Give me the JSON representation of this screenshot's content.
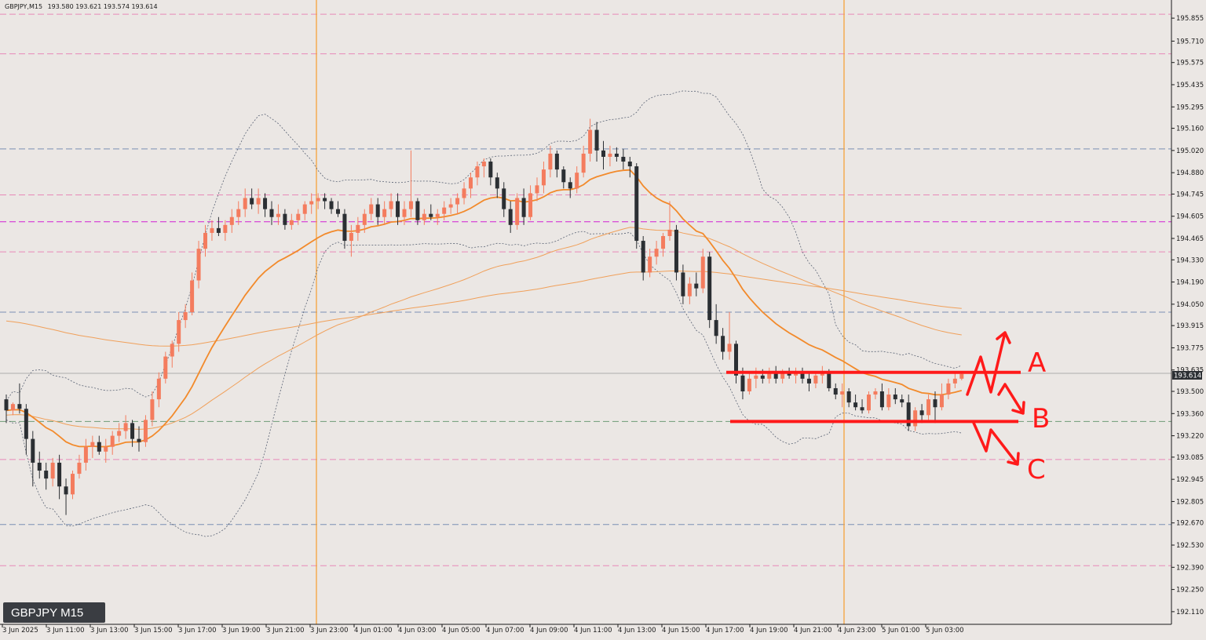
{
  "header": {
    "symbol_info": "GBPJPY,M15",
    "ohlc": "193.580 193.621 193.574 193.614"
  },
  "watermark": "GBPJPY M15",
  "current_price": "193.614",
  "scenario_labels": [
    "A",
    "B",
    "C"
  ],
  "colors": {
    "background": "#ebe7e4",
    "bull": "#f47c5e",
    "bear": "#2b2f33",
    "ema_fast": "#f28a2b",
    "ema_slow": "#f0a05a",
    "bands": "#5b6475",
    "session_line": "#f5a23a",
    "level_pink": "#e889b8",
    "level_magenta": "#d21fd2",
    "level_blue": "#7b8fb3",
    "level_green": "#6e9a76",
    "annotation": "#ff1a1a"
  },
  "chart_data": {
    "type": "candlestick",
    "title": "",
    "symbol": "GBPJPY",
    "timeframe": "M15",
    "ylim": [
      192.05,
      195.92
    ],
    "y_ticks": [
      "195.855",
      "195.710",
      "195.575",
      "195.435",
      "195.295",
      "195.160",
      "195.020",
      "194.880",
      "194.745",
      "194.605",
      "194.465",
      "194.330",
      "194.190",
      "194.050",
      "193.915",
      "193.775",
      "193.635",
      "193.500",
      "193.360",
      "193.220",
      "193.085",
      "192.945",
      "192.805",
      "192.670",
      "192.530",
      "192.390",
      "192.250",
      "192.110"
    ],
    "x_ticks": [
      "3 Jun 2025",
      "3 Jun 11:00",
      "3 Jun 13:00",
      "3 Jun 15:00",
      "3 Jun 17:00",
      "3 Jun 19:00",
      "3 Jun 21:00",
      "3 Jun 23:00",
      "4 Jun 01:00",
      "4 Jun 03:00",
      "4 Jun 05:00",
      "4 Jun 07:00",
      "4 Jun 09:00",
      "4 Jun 11:00",
      "4 Jun 13:00",
      "4 Jun 15:00",
      "4 Jun 17:00",
      "4 Jun 19:00",
      "4 Jun 21:00",
      "4 Jun 23:00",
      "5 Jun 01:00",
      "5 Jun 03:00"
    ],
    "candles": [
      [
        193.45,
        193.48,
        193.3,
        193.38
      ],
      [
        193.38,
        193.43,
        193.35,
        193.42
      ],
      [
        193.42,
        193.55,
        193.36,
        193.39
      ],
      [
        193.39,
        193.42,
        193.1,
        193.2
      ],
      [
        193.2,
        193.25,
        192.9,
        193.05
      ],
      [
        193.05,
        193.12,
        192.95,
        193.0
      ],
      [
        193.0,
        193.05,
        192.88,
        192.95
      ],
      [
        192.95,
        193.08,
        192.9,
        193.05
      ],
      [
        193.05,
        193.1,
        192.82,
        192.9
      ],
      [
        192.9,
        192.95,
        192.72,
        192.85
      ],
      [
        192.85,
        193.0,
        192.82,
        192.98
      ],
      [
        192.98,
        193.1,
        192.95,
        193.05
      ],
      [
        193.05,
        193.2,
        193.0,
        193.15
      ],
      [
        193.15,
        193.22,
        193.08,
        193.18
      ],
      [
        193.18,
        193.22,
        193.1,
        193.12
      ],
      [
        193.12,
        193.2,
        193.05,
        193.15
      ],
      [
        193.15,
        193.25,
        193.1,
        193.22
      ],
      [
        193.22,
        193.3,
        193.18,
        193.25
      ],
      [
        193.25,
        193.35,
        193.2,
        193.3
      ],
      [
        193.3,
        193.32,
        193.15,
        193.2
      ],
      [
        193.2,
        193.28,
        193.12,
        193.18
      ],
      [
        193.18,
        193.35,
        193.15,
        193.32
      ],
      [
        193.32,
        193.5,
        193.28,
        193.45
      ],
      [
        193.45,
        193.62,
        193.4,
        193.58
      ],
      [
        193.58,
        193.75,
        193.55,
        193.72
      ],
      [
        193.72,
        193.82,
        193.65,
        193.8
      ],
      [
        193.8,
        194.0,
        193.75,
        193.95
      ],
      [
        193.95,
        194.05,
        193.9,
        194.0
      ],
      [
        194.0,
        194.25,
        193.98,
        194.2
      ],
      [
        194.2,
        194.45,
        194.15,
        194.4
      ],
      [
        194.4,
        194.55,
        194.35,
        194.5
      ],
      [
        194.5,
        194.58,
        194.45,
        194.53
      ],
      [
        194.53,
        194.6,
        194.48,
        194.5
      ],
      [
        194.5,
        194.58,
        194.45,
        194.55
      ],
      [
        194.55,
        194.65,
        194.5,
        194.6
      ],
      [
        194.6,
        194.7,
        194.55,
        194.65
      ],
      [
        194.65,
        194.78,
        194.6,
        194.72
      ],
      [
        194.72,
        194.78,
        194.65,
        194.68
      ],
      [
        194.68,
        194.78,
        194.62,
        194.72
      ],
      [
        194.72,
        194.75,
        194.6,
        194.65
      ],
      [
        194.65,
        194.7,
        194.55,
        194.6
      ],
      [
        194.6,
        194.68,
        194.55,
        194.62
      ],
      [
        194.62,
        194.65,
        194.52,
        194.55
      ],
      [
        194.55,
        194.62,
        194.52,
        194.58
      ],
      [
        194.58,
        194.65,
        194.55,
        194.62
      ],
      [
        194.62,
        194.7,
        194.58,
        194.68
      ],
      [
        194.68,
        194.75,
        194.62,
        194.7
      ],
      [
        194.7,
        194.75,
        194.65,
        194.72
      ],
      [
        194.72,
        194.75,
        194.65,
        194.7
      ],
      [
        194.7,
        194.72,
        194.62,
        194.65
      ],
      [
        194.65,
        194.7,
        194.6,
        194.62
      ],
      [
        194.62,
        194.65,
        194.4,
        194.45
      ],
      [
        194.45,
        194.55,
        194.35,
        194.5
      ],
      [
        194.5,
        194.6,
        194.45,
        194.55
      ],
      [
        194.55,
        194.65,
        194.5,
        194.62
      ],
      [
        194.62,
        194.72,
        194.58,
        194.68
      ],
      [
        194.68,
        194.72,
        194.55,
        194.6
      ],
      [
        194.6,
        194.7,
        194.55,
        194.65
      ],
      [
        194.65,
        194.75,
        194.6,
        194.7
      ],
      [
        194.7,
        194.75,
        194.55,
        194.6
      ],
      [
        194.6,
        194.7,
        194.55,
        194.65
      ],
      [
        194.65,
        195.02,
        194.6,
        194.7
      ],
      [
        194.7,
        194.72,
        194.55,
        194.58
      ],
      [
        194.58,
        194.65,
        194.55,
        194.62
      ],
      [
        194.62,
        194.68,
        194.58,
        194.6
      ],
      [
        194.6,
        194.65,
        194.55,
        194.62
      ],
      [
        194.62,
        194.7,
        194.58,
        194.66
      ],
      [
        194.66,
        194.72,
        194.62,
        194.68
      ],
      [
        194.68,
        194.75,
        194.62,
        194.72
      ],
      [
        194.72,
        194.82,
        194.68,
        194.78
      ],
      [
        194.78,
        194.88,
        194.72,
        194.85
      ],
      [
        194.85,
        194.95,
        194.8,
        194.92
      ],
      [
        194.92,
        194.97,
        194.85,
        194.95
      ],
      [
        194.95,
        194.97,
        194.8,
        194.85
      ],
      [
        194.85,
        194.88,
        194.72,
        194.78
      ],
      [
        194.78,
        194.82,
        194.6,
        194.65
      ],
      [
        194.65,
        194.7,
        194.5,
        194.55
      ],
      [
        194.55,
        194.75,
        194.52,
        194.72
      ],
      [
        194.72,
        194.78,
        194.55,
        194.6
      ],
      [
        194.6,
        194.8,
        194.58,
        194.75
      ],
      [
        194.75,
        194.85,
        194.7,
        194.8
      ],
      [
        194.8,
        194.95,
        194.75,
        194.9
      ],
      [
        194.9,
        195.05,
        194.85,
        195.0
      ],
      [
        195.0,
        195.02,
        194.85,
        194.9
      ],
      [
        194.9,
        194.92,
        194.78,
        194.82
      ],
      [
        194.82,
        194.85,
        194.72,
        194.78
      ],
      [
        194.78,
        194.92,
        194.75,
        194.88
      ],
      [
        194.88,
        195.05,
        194.85,
        195.0
      ],
      [
        195.0,
        195.22,
        194.95,
        195.15
      ],
      [
        195.15,
        195.2,
        194.95,
        195.02
      ],
      [
        195.02,
        195.08,
        194.9,
        194.98
      ],
      [
        194.98,
        195.05,
        194.92,
        195.0
      ],
      [
        195.0,
        195.04,
        194.95,
        194.98
      ],
      [
        194.98,
        195.03,
        194.9,
        194.95
      ],
      [
        194.95,
        194.98,
        194.85,
        194.92
      ],
      [
        194.92,
        194.94,
        194.4,
        194.45
      ],
      [
        194.45,
        194.48,
        194.2,
        194.25
      ],
      [
        194.25,
        194.4,
        194.22,
        194.35
      ],
      [
        194.35,
        194.45,
        194.3,
        194.4
      ],
      [
        194.4,
        194.5,
        194.35,
        194.48
      ],
      [
        194.48,
        194.7,
        194.45,
        194.52
      ],
      [
        194.52,
        194.55,
        194.2,
        194.25
      ],
      [
        194.25,
        194.3,
        194.05,
        194.1
      ],
      [
        194.1,
        194.22,
        194.05,
        194.18
      ],
      [
        194.18,
        194.25,
        194.1,
        194.15
      ],
      [
        194.15,
        194.4,
        194.12,
        194.35
      ],
      [
        194.35,
        194.38,
        193.9,
        193.95
      ],
      [
        193.95,
        194.05,
        193.8,
        193.85
      ],
      [
        193.85,
        193.9,
        193.7,
        193.75
      ],
      [
        193.75,
        194.0,
        193.7,
        193.8
      ],
      [
        193.8,
        193.82,
        193.55,
        193.6
      ],
      [
        193.6,
        193.65,
        193.45,
        193.5
      ],
      [
        193.5,
        193.62,
        193.48,
        193.58
      ],
      [
        193.58,
        193.65,
        193.52,
        193.6
      ],
      [
        193.6,
        193.64,
        193.55,
        193.58
      ],
      [
        193.58,
        193.65,
        193.55,
        193.62
      ],
      [
        193.62,
        193.66,
        193.55,
        193.58
      ],
      [
        193.58,
        193.64,
        193.55,
        193.62
      ],
      [
        193.62,
        193.65,
        193.58,
        193.6
      ],
      [
        193.6,
        193.65,
        193.55,
        193.62
      ],
      [
        193.62,
        193.65,
        193.55,
        193.58
      ],
      [
        193.58,
        193.62,
        193.5,
        193.55
      ],
      [
        193.55,
        193.62,
        193.52,
        193.6
      ],
      [
        193.6,
        193.66,
        193.55,
        193.62
      ],
      [
        193.62,
        193.64,
        193.5,
        193.52
      ],
      [
        193.52,
        193.55,
        193.45,
        193.48
      ],
      [
        193.48,
        193.55,
        193.4,
        193.5
      ],
      [
        193.5,
        193.52,
        193.4,
        193.43
      ],
      [
        193.43,
        193.48,
        193.38,
        193.4
      ],
      [
        193.4,
        193.45,
        193.36,
        193.38
      ],
      [
        193.38,
        193.5,
        193.36,
        193.48
      ],
      [
        193.48,
        193.52,
        193.45,
        193.5
      ],
      [
        193.5,
        193.55,
        193.38,
        193.4
      ],
      [
        193.4,
        193.52,
        193.38,
        193.48
      ],
      [
        193.48,
        193.52,
        193.42,
        193.45
      ],
      [
        193.45,
        193.48,
        193.4,
        193.43
      ],
      [
        193.43,
        193.48,
        193.25,
        193.28
      ],
      [
        193.28,
        193.4,
        193.25,
        193.38
      ],
      [
        193.38,
        193.42,
        193.3,
        193.35
      ],
      [
        193.35,
        193.48,
        193.32,
        193.45
      ],
      [
        193.45,
        193.5,
        193.3,
        193.4
      ],
      [
        193.4,
        193.55,
        193.38,
        193.48
      ],
      [
        193.48,
        193.58,
        193.45,
        193.55
      ],
      [
        193.55,
        193.62,
        193.52,
        193.58
      ],
      [
        193.58,
        193.62,
        193.57,
        193.61
      ]
    ],
    "levels": [
      {
        "price": 195.88,
        "color": "pink"
      },
      {
        "price": 195.63,
        "color": "pink"
      },
      {
        "price": 195.03,
        "color": "blue"
      },
      {
        "price": 194.74,
        "color": "pink"
      },
      {
        "price": 194.57,
        "color": "magenta"
      },
      {
        "price": 194.38,
        "color": "pink"
      },
      {
        "price": 194.0,
        "color": "blue"
      },
      {
        "price": 193.31,
        "color": "green"
      },
      {
        "price": 193.07,
        "color": "pink"
      },
      {
        "price": 192.66,
        "color": "blue"
      },
      {
        "price": 192.4,
        "color": "pink"
      }
    ],
    "session_lines": [
      "3 Jun 23:00",
      "4 Jun 23:00"
    ],
    "grid": false,
    "legend": "none"
  }
}
